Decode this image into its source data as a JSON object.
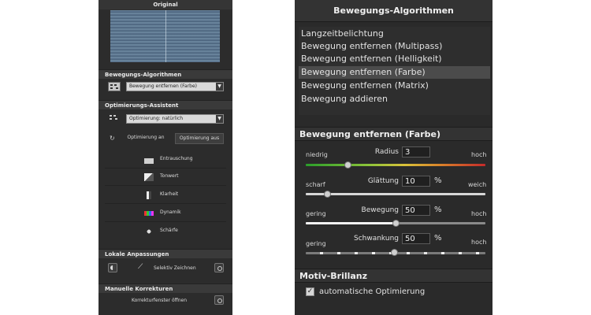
{
  "left": {
    "original_label": "Original",
    "algorithms_label": "Bewegungs-Algorithmen",
    "algorithm_value": "Bewegung entfernen (Farbe)",
    "assistant_label": "Optimierungs-Assistent",
    "optimization_value": "Optimierung: natürlich",
    "optimization_on": "Optimierung an",
    "optimization_off": "Optimierung aus",
    "tools": [
      {
        "label": "Entrauschung"
      },
      {
        "label": "Tonwert"
      },
      {
        "label": "Klarheit"
      },
      {
        "label": "Dynamik"
      },
      {
        "label": "Schärfe"
      }
    ],
    "local_label": "Lokale Anpassungen",
    "selective_draw": "Selektiv Zeichnen",
    "manual_label": "Manuelle Korrekturen",
    "correction_window": "Korrekturfenster öffnen"
  },
  "right": {
    "title": "Bewegungs-Algorithmen",
    "algorithms": [
      "Langzeitbelichtung",
      "Bewegung entfernen (Multipass)",
      "Bewegung entfernen (Helligkeit)",
      "Bewegung entfernen (Farbe)",
      "Bewegung entfernen (Matrix)",
      "Bewegung addieren"
    ],
    "selected_index": 3,
    "params_title": "Bewegung entfernen (Farbe)",
    "params": {
      "radius": {
        "label": "Radius",
        "value": "3",
        "left": "niedrig",
        "right": "hoch",
        "unit": ""
      },
      "glaettung": {
        "label": "Glättung",
        "value": "10",
        "left": "scharf",
        "right": "weich",
        "unit": "%"
      },
      "bewegung": {
        "label": "Bewegung",
        "value": "50",
        "left": "gering",
        "right": "hoch",
        "unit": "%"
      },
      "schwankung": {
        "label": "Schwankung",
        "value": "50",
        "left": "gering",
        "right": "hoch",
        "unit": "%"
      }
    },
    "brilliance_title": "Motiv-Brillanz",
    "auto_opt_label": "automatische Optimierung",
    "auto_opt_checked": "✓"
  },
  "colors": {
    "panel_bg": "#2a2a2a",
    "header_bg": "#333333",
    "selected_bg": "#4b4b4b"
  }
}
